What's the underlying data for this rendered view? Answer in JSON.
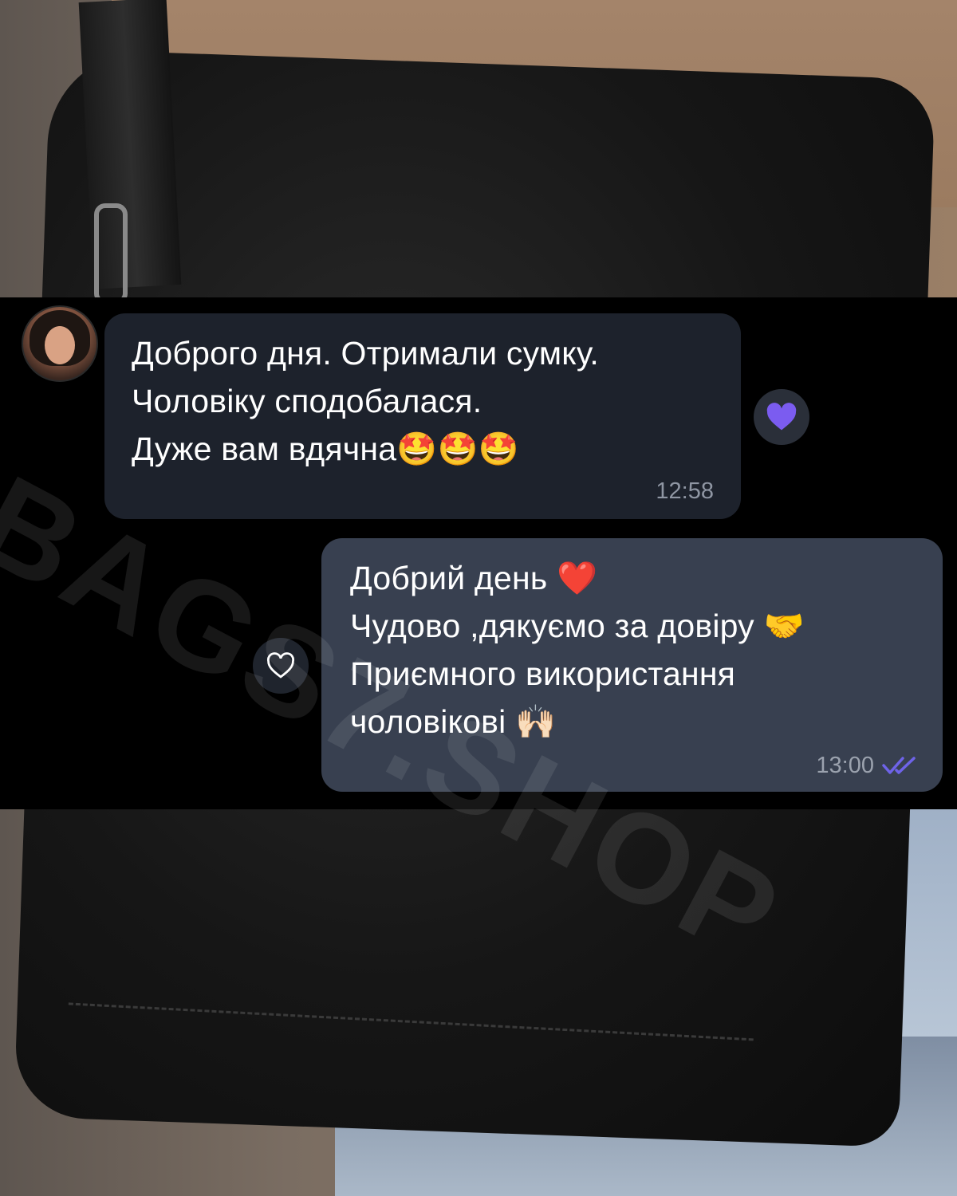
{
  "watermark": "BAGS7.SHOP",
  "incoming": {
    "lines": [
      "Доброго дня. Отримали сумку.",
      "Чоловіку сподобалася.",
      "Дуже вам вдячна🤩🤩🤩"
    ],
    "time": "12:58",
    "reaction": "purple-heart"
  },
  "outgoing": {
    "lines": [
      "Добрий день ❤️",
      "Чудово ,дякуємо за довіру 🤝",
      "Приємного використання",
      "чоловікові 🙌🏻"
    ],
    "time": "13:00",
    "read_status": "double-check",
    "reaction": "empty-heart"
  },
  "colors": {
    "incoming_bubble": "#1d222c",
    "outgoing_bubble": "#384050",
    "accent": "#7b5cf0",
    "read_ticks": "#6e63e8"
  }
}
